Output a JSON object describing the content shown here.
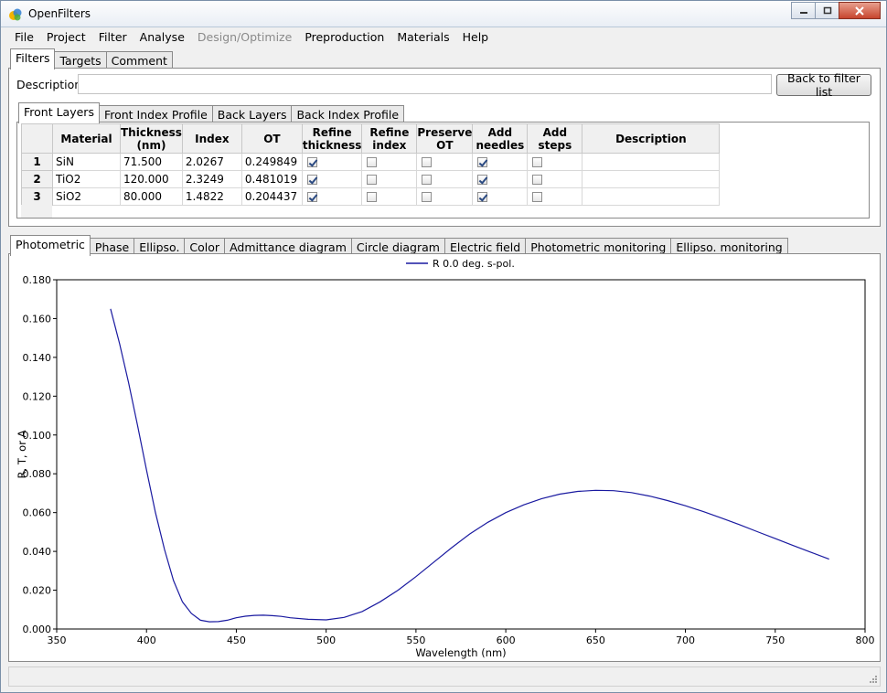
{
  "window": {
    "title": "OpenFilters"
  },
  "menu": [
    {
      "label": "File",
      "enabled": true
    },
    {
      "label": "Project",
      "enabled": true
    },
    {
      "label": "Filter",
      "enabled": true
    },
    {
      "label": "Analyse",
      "enabled": true
    },
    {
      "label": "Design/Optimize",
      "enabled": false
    },
    {
      "label": "Preproduction",
      "enabled": true
    },
    {
      "label": "Materials",
      "enabled": true
    },
    {
      "label": "Help",
      "enabled": true
    }
  ],
  "top_tabs": [
    "Filters",
    "Targets",
    "Comment"
  ],
  "description": {
    "label": "Description:",
    "value": ""
  },
  "back_button": "Back to filter list",
  "layer_tabs": [
    "Front Layers",
    "Front Index Profile",
    "Back Layers",
    "Back Index Profile"
  ],
  "table": {
    "columns": [
      "",
      "Material",
      "Thickness\n(nm)",
      "Index",
      "OT",
      "Refine\nthickness",
      "Refine\nindex",
      "Preserve\nOT",
      "Add\nneedles",
      "Add\nsteps",
      "Description"
    ],
    "rows": [
      {
        "num": "1",
        "material": "SiN",
        "thickness": "71.500",
        "index": "2.0267",
        "ot": "0.249849",
        "refine_thickness": true,
        "refine_index": false,
        "preserve_ot": false,
        "add_needles": true,
        "add_steps": false,
        "description": ""
      },
      {
        "num": "2",
        "material": "TiO2",
        "thickness": "120.000",
        "index": "2.3249",
        "ot": "0.481019",
        "refine_thickness": true,
        "refine_index": false,
        "preserve_ot": false,
        "add_needles": true,
        "add_steps": false,
        "description": ""
      },
      {
        "num": "3",
        "material": "SiO2",
        "thickness": "80.000",
        "index": "1.4822",
        "ot": "0.204437",
        "refine_thickness": true,
        "refine_index": false,
        "preserve_ot": false,
        "add_needles": true,
        "add_steps": false,
        "description": ""
      }
    ]
  },
  "analysis_tabs": [
    "Photometric",
    "Phase",
    "Ellipso.",
    "Color",
    "Admittance diagram",
    "Circle diagram",
    "Electric field",
    "Photometric monitoring",
    "Ellipso. monitoring"
  ],
  "colors": {
    "series": "#1a1aa0"
  },
  "chart_data": {
    "type": "line",
    "title": "",
    "xlabel": "Wavelength (nm)",
    "ylabel": "R, T, or A",
    "xlim": [
      350,
      800
    ],
    "ylim": [
      0,
      0.18
    ],
    "xticks": [
      "350",
      "400",
      "450",
      "500",
      "550",
      "600",
      "650",
      "700",
      "750",
      "800"
    ],
    "yticks": [
      "0.000",
      "0.020",
      "0.040",
      "0.060",
      "0.080",
      "0.100",
      "0.120",
      "0.140",
      "0.160",
      "0.180"
    ],
    "legend_position": "top-center",
    "grid": false,
    "series": [
      {
        "name": "R 0.0 deg. s-pol.",
        "x": [
          380,
          385,
          390,
          395,
          400,
          405,
          410,
          415,
          420,
          425,
          430,
          435,
          440,
          445,
          450,
          455,
          460,
          465,
          470,
          475,
          480,
          490,
          500,
          510,
          520,
          530,
          540,
          550,
          560,
          570,
          580,
          590,
          600,
          610,
          620,
          630,
          640,
          650,
          660,
          670,
          680,
          690,
          700,
          710,
          720,
          730,
          740,
          750,
          760,
          770,
          780
        ],
        "y": [
          0.165,
          0.147,
          0.127,
          0.105,
          0.082,
          0.06,
          0.041,
          0.025,
          0.014,
          0.008,
          0.0045,
          0.0037,
          0.0038,
          0.0045,
          0.0058,
          0.0066,
          0.007,
          0.0071,
          0.0069,
          0.0065,
          0.0058,
          0.005,
          0.0047,
          0.006,
          0.009,
          0.014,
          0.02,
          0.027,
          0.0345,
          0.042,
          0.049,
          0.055,
          0.06,
          0.064,
          0.0672,
          0.0695,
          0.0709,
          0.0715,
          0.0713,
          0.0703,
          0.0685,
          0.0662,
          0.0635,
          0.0605,
          0.0572,
          0.0538,
          0.0502,
          0.0466,
          0.043,
          0.0395,
          0.036
        ]
      }
    ]
  }
}
